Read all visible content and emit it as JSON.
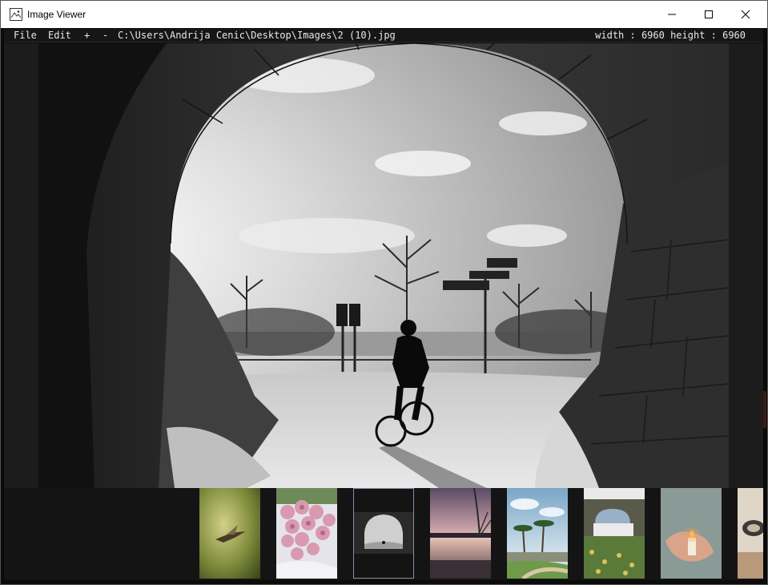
{
  "window": {
    "title": "Image Viewer",
    "icons": {
      "app": "image-viewer-icon",
      "minimize": "minimize-icon",
      "maximize": "maximize-icon",
      "close": "close-icon"
    }
  },
  "menubar": {
    "file": "File",
    "edit": "Edit",
    "zoom_in": "+",
    "zoom_out": "-",
    "path": "C:\\Users\\Andrija Cenic\\Desktop\\Images\\2 (10).jpg",
    "dimensions": "width : 6960 height : 6960"
  },
  "viewer": {
    "image_description_icon": "tunnel-cyclist-photo"
  },
  "thumbnails": [
    {
      "name": "thumb-hummingbird",
      "selected": false
    },
    {
      "name": "thumb-roses",
      "selected": false
    },
    {
      "name": "thumb-tunnel",
      "selected": true
    },
    {
      "name": "thumb-sunset-lake",
      "selected": false
    },
    {
      "name": "thumb-palms",
      "selected": false
    },
    {
      "name": "thumb-aqueduct",
      "selected": false
    },
    {
      "name": "thumb-candle-hand",
      "selected": false
    },
    {
      "name": "thumb-partial",
      "selected": false
    }
  ],
  "colors": {
    "selection_outline": "#9a86a8",
    "menubar_bg": "#161616",
    "strip_bg": "#141414"
  }
}
